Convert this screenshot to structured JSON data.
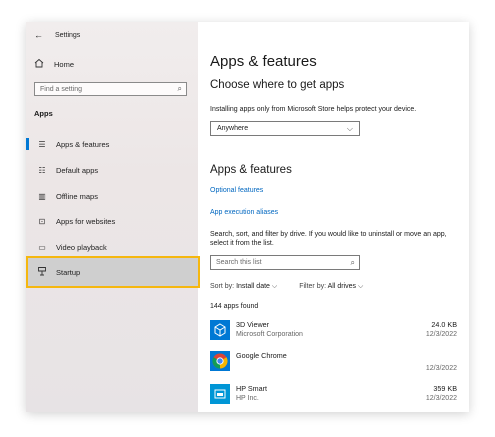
{
  "window": {
    "title": "Settings"
  },
  "sidebar": {
    "home": "Home",
    "search_placeholder": "Find a setting",
    "section": "Apps",
    "items": [
      {
        "label": "Apps & features",
        "icon": "list-icon",
        "active": true
      },
      {
        "label": "Default apps",
        "icon": "default-apps-icon"
      },
      {
        "label": "Offline maps",
        "icon": "map-icon"
      },
      {
        "label": "Apps for websites",
        "icon": "websites-icon"
      },
      {
        "label": "Video playback",
        "icon": "video-icon"
      },
      {
        "label": "Startup",
        "icon": "startup-icon"
      }
    ]
  },
  "main": {
    "title": "Apps & features",
    "choose_heading": "Choose where to get apps",
    "choose_desc": "Installing apps only from Microsoft Store helps protect your device.",
    "dropdown_value": "Anywhere",
    "apps_heading": "Apps & features",
    "link_optional": "Optional features",
    "link_aliases": "App execution aliases",
    "search_desc": "Search, sort, and filter by drive. If you would like to uninstall or move an app, select it from the list.",
    "search_placeholder": "Search this list",
    "sort_label": "Sort by:",
    "sort_value": "Install date",
    "filter_label": "Filter by:",
    "filter_value": "All drives",
    "count": "144 apps found",
    "apps": [
      {
        "name": "3D Viewer",
        "publisher": "Microsoft Corporation",
        "size": "24.0 KB",
        "date": "12/3/2022"
      },
      {
        "name": "Google Chrome",
        "publisher": "",
        "size": "",
        "date": "12/3/2022"
      },
      {
        "name": "HP Smart",
        "publisher": "HP Inc.",
        "size": "359 KB",
        "date": "12/3/2022"
      }
    ]
  },
  "colors": {
    "accent": "#0078d4",
    "link": "#0067c0",
    "highlight": "#f5b70f"
  }
}
